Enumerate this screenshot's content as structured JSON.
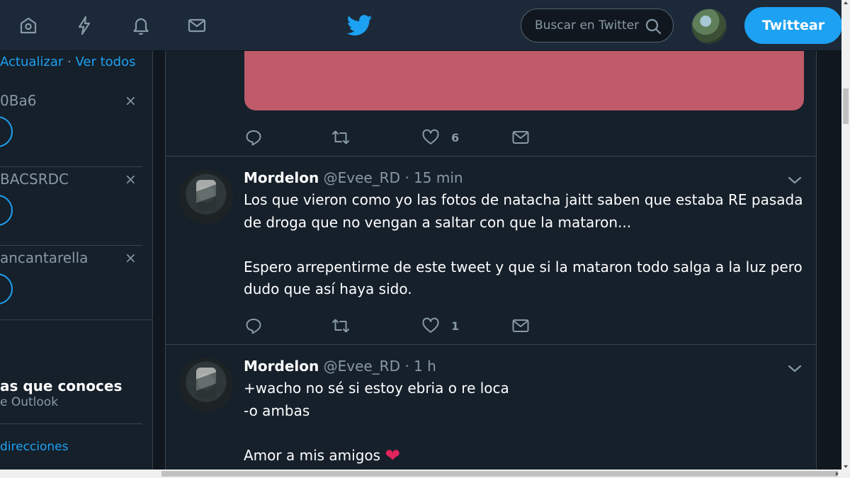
{
  "colors": {
    "accent": "#1da1f2",
    "background": "#10171e",
    "card": "#15202b",
    "topbar": "#1c2938",
    "muted": "#8899a6",
    "media_card": "#be5a6a",
    "heart": "#e0245e"
  },
  "topnav": {
    "icons": [
      "home-icon",
      "moments-icon",
      "notifications-icon",
      "messages-icon"
    ],
    "logo": "twitter-bird-icon",
    "search_placeholder": "Buscar en Twitter",
    "tweet_button": "Twittear"
  },
  "sidebar": {
    "header": {
      "refresh": "Actualizar",
      "separator": "·",
      "view_all": "Ver todos"
    },
    "suggestions": [
      {
        "name": "0Ba6"
      },
      {
        "name": "BACSRDC"
      },
      {
        "name": "ancantarella"
      }
    ],
    "dismiss": "×",
    "find_people": {
      "title": "as que conoces",
      "subtitle": "e Outlook",
      "link": "direcciones"
    }
  },
  "timeline": {
    "first_tweet_actions": {
      "likes": "6"
    },
    "tweets": [
      {
        "display_name": "Mordelon",
        "handle": "@Evee_RD",
        "dot": "·",
        "time": "15 min",
        "body": [
          "Los que vieron como yo las fotos de natacha jaitt saben que estaba RE pasada de droga que no vengan a saltar con que la mataron...",
          "",
          "Espero arrepentirme de este tweet y que si la mataron todo salga a la luz pero dudo que así haya sido."
        ],
        "likes": "1"
      },
      {
        "display_name": "Mordelon",
        "handle": "@Evee_RD",
        "dot": "·",
        "time": "1 h",
        "body": [
          "+wacho no sé si estoy ebria o re loca",
          "-o ambas",
          "",
          "Amor a mis amigos"
        ],
        "emoji": "❤"
      }
    ]
  }
}
